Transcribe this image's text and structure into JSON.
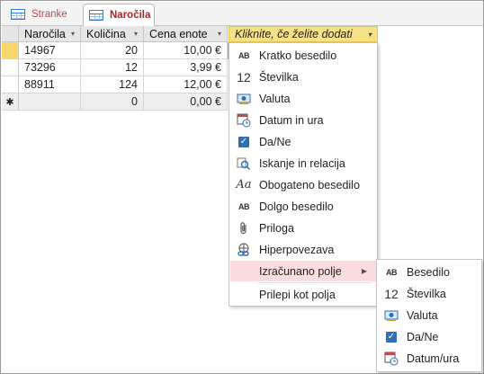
{
  "tabs": [
    {
      "label": "Stranke",
      "active": false
    },
    {
      "label": "Naročila",
      "active": true
    }
  ],
  "table": {
    "columns": [
      "Naročila",
      "Količina",
      "Cena enote",
      "Kliknite, če želite dodati"
    ],
    "rows": [
      [
        "14967",
        "20",
        "10,00 €"
      ],
      [
        "73296",
        "12",
        "3,99 €"
      ],
      [
        "88911",
        "124",
        "12,00 €"
      ]
    ],
    "new_row": {
      "marker": "✱",
      "quantity": "0",
      "price": "0,00 €"
    }
  },
  "field_type_menu": [
    {
      "label": "Kratko besedilo",
      "icon": "short-text-icon"
    },
    {
      "label": "Številka",
      "icon": "number-icon"
    },
    {
      "label": "Valuta",
      "icon": "currency-icon"
    },
    {
      "label": "Datum in ura",
      "icon": "datetime-icon"
    },
    {
      "label": "Da/Ne",
      "icon": "yesno-icon"
    },
    {
      "label": "Iskanje in relacija",
      "icon": "lookup-icon"
    },
    {
      "label": "Obogateno besedilo",
      "icon": "rich-text-icon"
    },
    {
      "label": "Dolgo besedilo",
      "icon": "long-text-icon"
    },
    {
      "label": "Priloga",
      "icon": "attachment-icon"
    },
    {
      "label": "Hiperpovezava",
      "icon": "hyperlink-icon"
    },
    {
      "label": "Izračunano polje",
      "icon": "",
      "submenu": true
    },
    {
      "label": "Prilepi kot polja",
      "icon": ""
    }
  ],
  "calculated_submenu": [
    {
      "label": "Besedilo",
      "icon": "short-text-icon"
    },
    {
      "label": "Številka",
      "icon": "number-icon"
    },
    {
      "label": "Valuta",
      "icon": "currency-icon"
    },
    {
      "label": "Da/Ne",
      "icon": "yesno-icon"
    },
    {
      "label": "Datum/ura",
      "icon": "datetime-icon"
    }
  ],
  "colors": {
    "highlight": "#fbdcdf",
    "add_column": "#f6e187",
    "accent": "#a4262c"
  }
}
